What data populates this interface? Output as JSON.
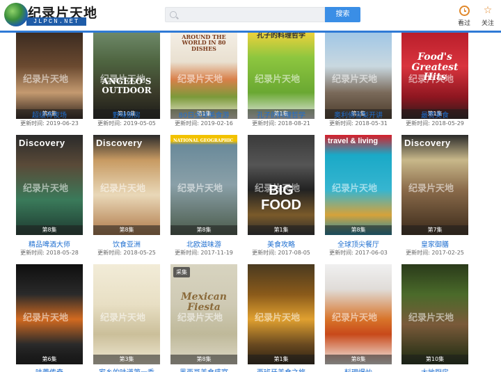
{
  "header": {
    "logo_title": "纪录片天地",
    "logo_sub": "JLPCN.NET",
    "search_placeholder": "",
    "search_button": "搜索",
    "history_label": "看过",
    "follow_label": "关注"
  },
  "colors": {
    "accent": "#2f7ad6",
    "link": "#1f6fd0",
    "icon": "#e0872a"
  },
  "date_prefix": "更新时间:",
  "watermark": "纪录片天地",
  "rows": [
    [
      {
        "title": "超级宵夜场",
        "date": "2019-06-23",
        "episode": "第6集",
        "poster_text": ""
      },
      {
        "title": "野味厨房",
        "date": "2019-05-05",
        "episode": "第10集",
        "poster_text": "ANGELO'S OUTDOOR"
      },
      {
        "title": "80日全球美食游",
        "date": "2019-02-16",
        "episode": "第1集",
        "poster_text": "AROUND THE WORLD IN 80 DISHES"
      },
      {
        "title": "孔子的料理哲学",
        "date": "2018-08-21",
        "episode": "第1集",
        "poster_text": "孔子的料理哲学"
      },
      {
        "title": "奥利佛雪梨开讲",
        "date": "2018-05-31",
        "episode": "第1集",
        "poster_text": ""
      },
      {
        "title": "最赞美食",
        "date": "2018-05-29",
        "episode": "第1集",
        "poster_text": "Food's Greatest Hits"
      }
    ],
    [
      {
        "title": "精品啤酒大师",
        "date": "2018-05-28",
        "episode": "第8集",
        "poster_text": "Discovery"
      },
      {
        "title": "饮食亚洲",
        "date": "2018-05-25",
        "episode": "第8集",
        "poster_text": "Discovery"
      },
      {
        "title": "北欧滋味游",
        "date": "2017-11-19",
        "episode": "第8集",
        "poster_text": "NATIONAL GEOGRAPHIC"
      },
      {
        "title": "美食攻略",
        "date": "2017-08-05",
        "episode": "第1集",
        "poster_text": "BIG FOOD"
      },
      {
        "title": "全球顶尖餐厅",
        "date": "2017-06-03",
        "episode": "第8集",
        "poster_text": "travel & living"
      },
      {
        "title": "皇家御膳",
        "date": "2017-02-25",
        "episode": "第7集",
        "poster_text": "Discovery"
      }
    ],
    [
      {
        "title": "味蕾传奇",
        "date": "",
        "episode": "第6集",
        "poster_text": ""
      },
      {
        "title": "家乡的味道第一季",
        "date": "",
        "episode": "第3集",
        "poster_text": ""
      },
      {
        "title": "墨西哥美食盛宴",
        "date": "",
        "episode": "第8集",
        "poster_text": "Mexican Fiesta",
        "badge": "采集"
      },
      {
        "title": "西班牙美食之旅",
        "date": "",
        "episode": "第1集",
        "poster_text": ""
      },
      {
        "title": "料理爆炒",
        "date": "",
        "episode": "第8集",
        "poster_text": ""
      },
      {
        "title": "大地厨房",
        "date": "",
        "episode": "第10集",
        "poster_text": ""
      }
    ]
  ]
}
